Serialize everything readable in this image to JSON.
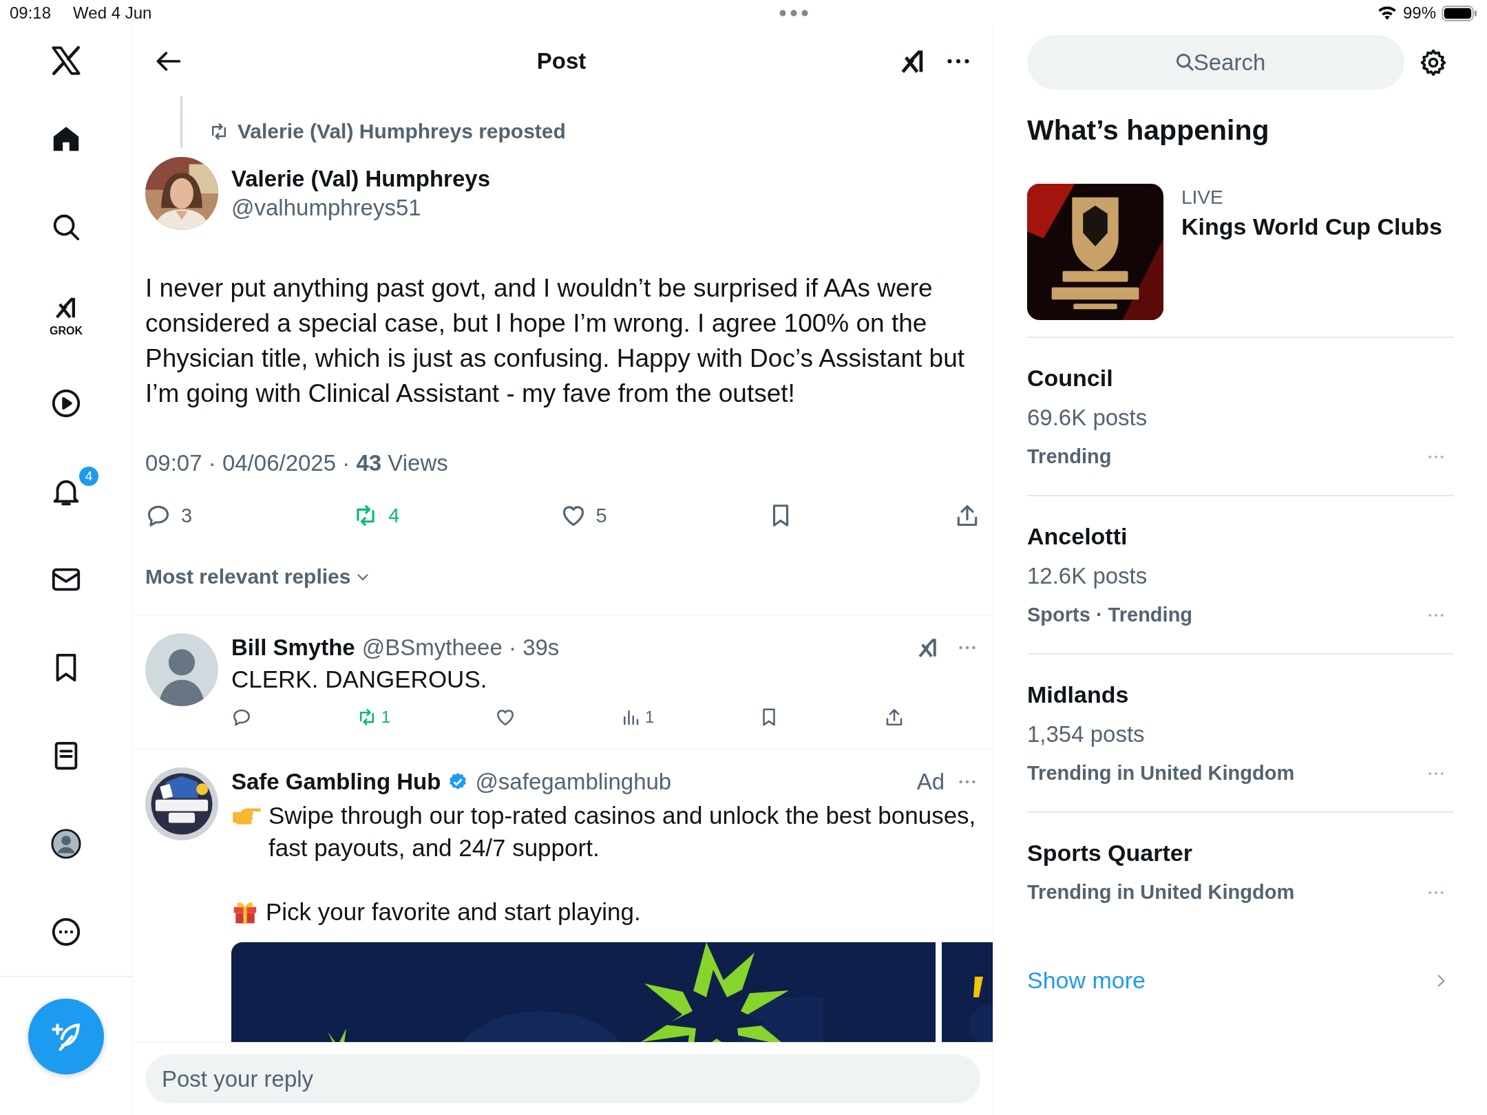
{
  "status_bar": {
    "time": "09:18",
    "date": "Wed 4 Jun",
    "battery": "99%"
  },
  "nav": {
    "items": [
      {
        "kind": "logo"
      },
      {
        "kind": "home"
      },
      {
        "kind": "search"
      },
      {
        "kind": "grok",
        "label": "GROK"
      },
      {
        "kind": "video"
      },
      {
        "kind": "notifications",
        "badge": "4"
      },
      {
        "kind": "messages"
      },
      {
        "kind": "bookmarks"
      },
      {
        "kind": "lists"
      },
      {
        "kind": "profile"
      },
      {
        "kind": "more"
      }
    ]
  },
  "header": {
    "title": "Post"
  },
  "post": {
    "repost_label": "Valerie (Val) Humphreys reposted",
    "name": "Valerie (Val) Humphreys",
    "handle": "@valhumphreys51",
    "text": "I never put anything past govt, and I wouldn’t be surprised if AAs were considered a special case, but I hope I’m wrong. I agree 100% on the Physician title, which is just as confusing. Happy with Doc’s Assistant but I’m going with Clinical Assistant - my fave from the outset!",
    "meta": "09:07 · 04/06/2025 · **43** Views",
    "actions": [
      {
        "kind": "reply",
        "count": "3",
        "active": false
      },
      {
        "kind": "repost",
        "count": "4",
        "active": true
      },
      {
        "kind": "like",
        "count": "5",
        "active": false
      },
      {
        "kind": "bookmark",
        "active": false
      },
      {
        "kind": "share",
        "active": false
      }
    ]
  },
  "replies_sort": "Most relevant replies",
  "replies": [
    {
      "kind": "reply",
      "name": "Bill Smythe",
      "byline": "@BSmytheee · 39s",
      "text": "CLERK. DANGEROUS.",
      "actions": [
        {
          "kind": "reply",
          "active": false
        },
        {
          "kind": "repost",
          "count": "1",
          "active": true
        },
        {
          "kind": "like",
          "active": false
        },
        {
          "kind": "views",
          "count": "1",
          "active": false
        },
        {
          "kind": "bookmark",
          "active": false
        },
        {
          "kind": "share",
          "active": false
        }
      ]
    },
    {
      "kind": "ad",
      "name": "Safe Gambling Hub",
      "verified": true,
      "byline": "@safegamblinghub",
      "ad_label": "Ad",
      "paragraphs": [
        {
          "kind": "pointer",
          "text": "Swipe through our top-rated casinos and unlock the best bonuses, fast payouts, and 24/7 support."
        },
        {
          "kind": "gift",
          "text": "Pick your favorite and start playing."
        }
      ]
    }
  ],
  "reply_box": {
    "placeholder": "Post your reply"
  },
  "sidebar": {
    "search": {
      "placeholder": "Search"
    },
    "heading": "What’s happening",
    "live": {
      "label": "LIVE",
      "title": "Kings World Cup Clubs"
    },
    "trends": [
      {
        "title": "Council",
        "posts": "69.6K posts",
        "meta": "Trending"
      },
      {
        "title": "Ancelotti",
        "posts": "12.6K posts",
        "meta": "Sports · Trending"
      },
      {
        "title": "Midlands",
        "posts": "1,354 posts",
        "meta": "Trending in United Kingdom"
      },
      {
        "title": "Sports Quarter",
        "meta": "Trending in United Kingdom"
      }
    ],
    "show_more": "Show more"
  }
}
